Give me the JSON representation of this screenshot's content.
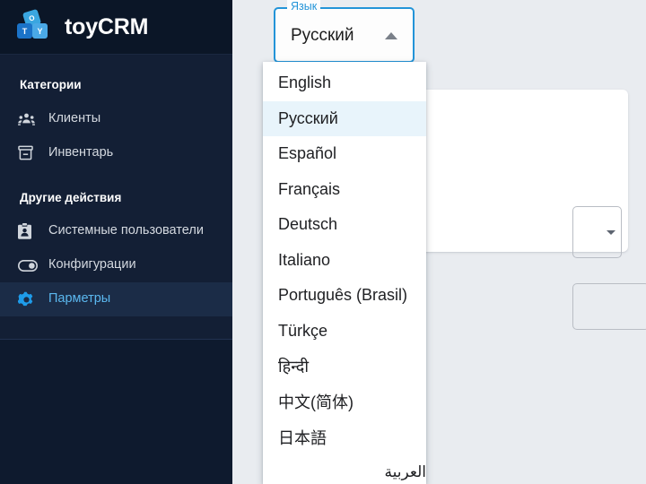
{
  "app": {
    "brand": "toyCRM",
    "logo_letters": {
      "top": "O",
      "left": "T",
      "right": "Y"
    },
    "accent_color": "#2394d8",
    "sidebar_bg": "#131f35",
    "header_bg": "#0b1627"
  },
  "sidebar": {
    "sections": [
      {
        "title": "Категории",
        "items": [
          {
            "label": "Клиенты",
            "icon": "people-group-icon",
            "active": false
          },
          {
            "label": "Инвентарь",
            "icon": "inventory-box-icon",
            "active": false
          }
        ]
      },
      {
        "title": "Другие действия",
        "items": [
          {
            "label": "Системные пользователи",
            "icon": "id-badge-icon",
            "active": false
          },
          {
            "label": "Конфигурации",
            "icon": "toggle-switch-icon",
            "active": false
          },
          {
            "label": "Парметры",
            "icon": "gear-icon",
            "active": true
          }
        ]
      }
    ]
  },
  "language_select": {
    "label": "Язык",
    "value": "Русский",
    "expanded": true,
    "arrow_icon": "chevron-up-icon",
    "options": [
      {
        "label": "English",
        "selected": false,
        "rtl": false
      },
      {
        "label": "Русский",
        "selected": true,
        "rtl": false
      },
      {
        "label": "Español",
        "selected": false,
        "rtl": false
      },
      {
        "label": "Français",
        "selected": false,
        "rtl": false
      },
      {
        "label": "Deutsch",
        "selected": false,
        "rtl": false
      },
      {
        "label": "Italiano",
        "selected": false,
        "rtl": false
      },
      {
        "label": "Português (Brasil)",
        "selected": false,
        "rtl": false
      },
      {
        "label": "Türkçe",
        "selected": false,
        "rtl": false
      },
      {
        "label": "हिन्दी",
        "selected": false,
        "rtl": false
      },
      {
        "label": "中文(简体)",
        "selected": false,
        "rtl": false
      },
      {
        "label": "日本語",
        "selected": false,
        "rtl": false
      },
      {
        "label": "العربية",
        "selected": false,
        "rtl": true
      }
    ]
  },
  "content": {
    "card_present": true,
    "fields": [
      {
        "type": "select",
        "value": "",
        "icon": "chevron-down-icon"
      },
      {
        "type": "text",
        "value": ""
      }
    ]
  }
}
